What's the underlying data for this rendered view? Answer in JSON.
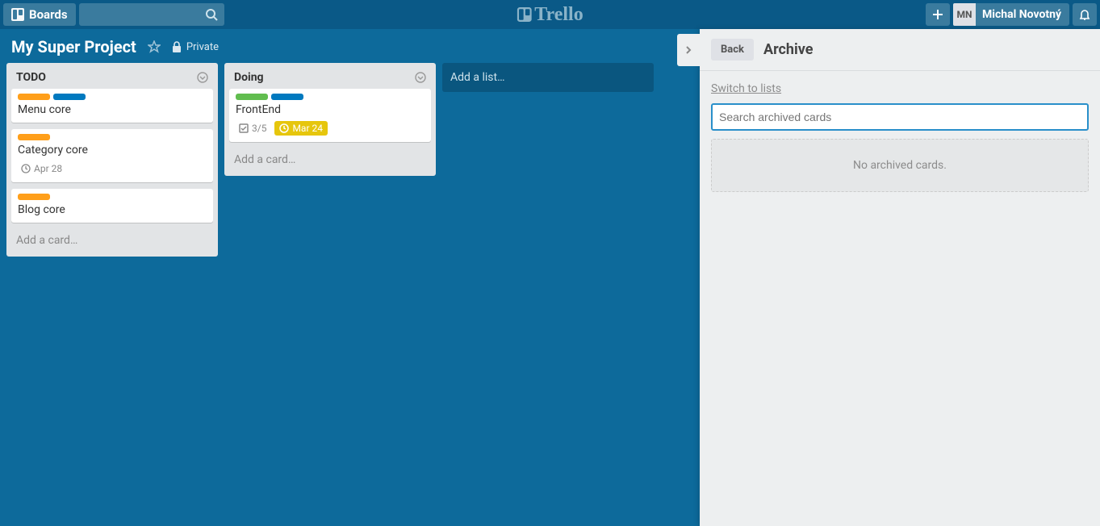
{
  "header": {
    "boards_label": "Boards",
    "logo_text": "Trello",
    "user_initials": "MN",
    "user_name": "Michal Novotný"
  },
  "board": {
    "name": "My Super Project",
    "visibility": "Private"
  },
  "lists": [
    {
      "title": "TODO",
      "add_card": "Add a card…",
      "cards": [
        {
          "labels": [
            "orange",
            "blue"
          ],
          "title": "Menu core"
        },
        {
          "labels": [
            "orange"
          ],
          "title": "Category core",
          "due_plain": "Apr 28"
        },
        {
          "labels": [
            "orange"
          ],
          "title": "Blog core"
        }
      ]
    },
    {
      "title": "Doing",
      "add_card": "Add a card…",
      "cards": [
        {
          "labels": [
            "green",
            "blue"
          ],
          "title": "FrontEnd",
          "checklist": "3/5",
          "due": "Mar 24"
        }
      ]
    }
  ],
  "add_list": "Add a list…",
  "panel": {
    "back": "Back",
    "title": "Archive",
    "switch": "Switch to lists",
    "search_placeholder": "Search archived cards",
    "empty": "No archived cards."
  }
}
